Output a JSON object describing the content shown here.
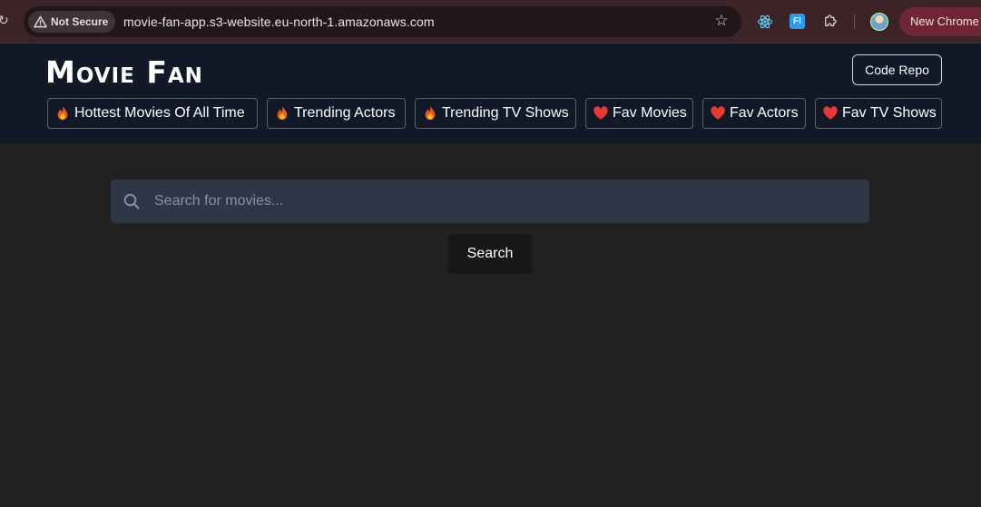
{
  "browser": {
    "security_label": "Not Secure",
    "url": "movie-fan-app.s3-website.eu-north-1.amazonaws.com",
    "new_chrome_label": "New Chrome",
    "extension_fi_label": "FI",
    "icons": [
      "reload-icon",
      "warning-icon",
      "star-icon",
      "react-devtools-icon",
      "fi-extension-icon",
      "puzzle-icon",
      "avatar"
    ]
  },
  "header": {
    "logo": "Movie Fan",
    "code_repo_label": "Code Repo",
    "background": "#111827"
  },
  "nav": {
    "items": [
      {
        "icon": "fire-icon",
        "label": "Hottest Movies Of All Time"
      },
      {
        "icon": "fire-icon",
        "label": "Trending Actors"
      },
      {
        "icon": "fire-icon",
        "label": "Trending TV Shows"
      },
      {
        "icon": "heart-icon",
        "label": "Fav Movies"
      },
      {
        "icon": "heart-icon",
        "label": "Fav Actors"
      },
      {
        "icon": "heart-icon",
        "label": "Fav TV Shows"
      }
    ]
  },
  "search": {
    "placeholder": "Search for movies...",
    "value": "",
    "button_label": "Search"
  },
  "colors": {
    "page_background": "#202020",
    "search_background": "#2d3748",
    "chrome_tint": "#3b2327",
    "new_chrome_pill": "#6f2634"
  }
}
